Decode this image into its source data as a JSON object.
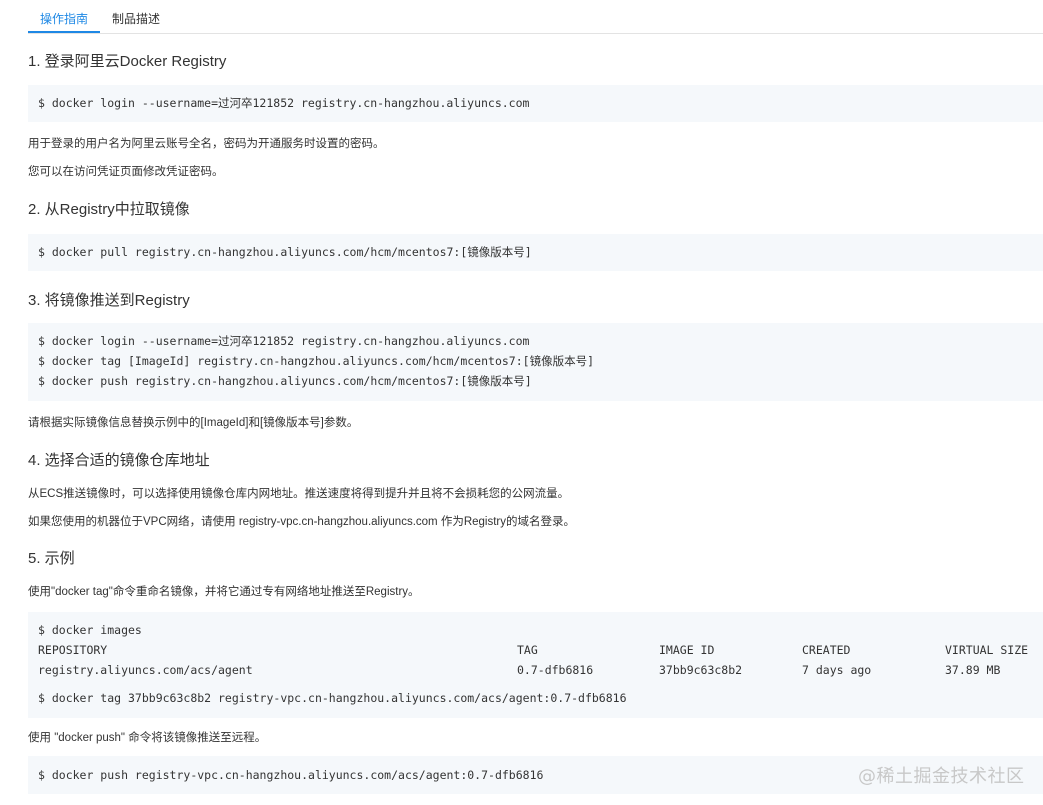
{
  "tabs": [
    {
      "label": "操作指南"
    },
    {
      "label": "制品描述"
    }
  ],
  "sections": {
    "s1": {
      "title": "1. 登录阿里云Docker Registry",
      "code": [
        "$ docker login --username=过河卒121852 registry.cn-hangzhou.aliyuncs.com"
      ],
      "notes": [
        "用于登录的用户名为阿里云账号全名，密码为开通服务时设置的密码。",
        "您可以在访问凭证页面修改凭证密码。"
      ]
    },
    "s2": {
      "title": "2. 从Registry中拉取镜像",
      "code": [
        "$ docker pull registry.cn-hangzhou.aliyuncs.com/hcm/mcentos7:[镜像版本号]"
      ]
    },
    "s3": {
      "title": "3. 将镜像推送到Registry",
      "code": [
        "$ docker login --username=过河卒121852 registry.cn-hangzhou.aliyuncs.com",
        "$ docker tag [ImageId] registry.cn-hangzhou.aliyuncs.com/hcm/mcentos7:[镜像版本号]",
        "$ docker push registry.cn-hangzhou.aliyuncs.com/hcm/mcentos7:[镜像版本号]"
      ],
      "note": "请根据实际镜像信息替换示例中的[ImageId]和[镜像版本号]参数。"
    },
    "s4": {
      "title": "4. 选择合适的镜像仓库地址",
      "notes": [
        "从ECS推送镜像时，可以选择使用镜像仓库内网地址。推送速度将得到提升并且将不会损耗您的公网流量。",
        "如果您使用的机器位于VPC网络，请使用 registry-vpc.cn-hangzhou.aliyuncs.com 作为Registry的域名登录。"
      ]
    },
    "s5": {
      "title": "5. 示例",
      "intro": "使用\"docker tag\"命令重命名镜像，并将它通过专有网络地址推送至Registry。",
      "cmd_images": "$ docker images",
      "table_headers": [
        "REPOSITORY",
        "TAG",
        "IMAGE ID",
        "CREATED",
        "VIRTUAL SIZE"
      ],
      "table_row": [
        "registry.aliyuncs.com/acs/agent",
        "0.7-dfb6816",
        "37bb9c63c8b2",
        "7 days ago",
        "37.89 MB"
      ],
      "cmd_tag": "$ docker tag 37bb9c63c8b2 registry-vpc.cn-hangzhou.aliyuncs.com/acs/agent:0.7-dfb6816",
      "push_note": "使用 \"docker push\" 命令将该镜像推送至远程。",
      "cmd_push": "$ docker push registry-vpc.cn-hangzhou.aliyuncs.com/acs/agent:0.7-dfb6816"
    }
  },
  "watermark": "@稀土掘金技术社区"
}
